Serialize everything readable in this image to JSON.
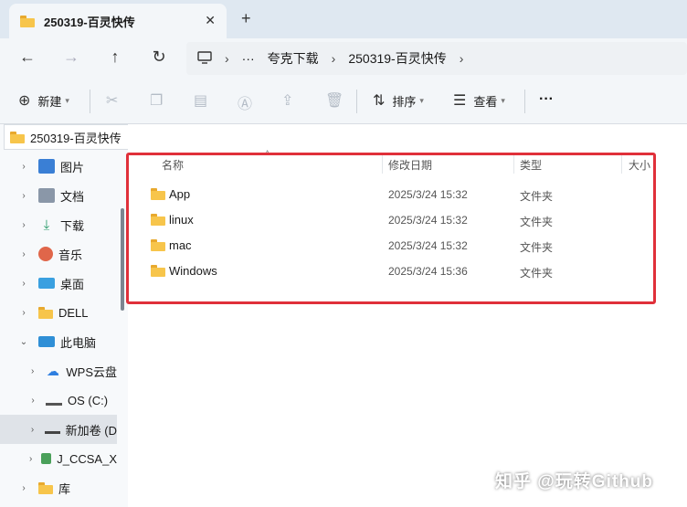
{
  "tab": {
    "title": "250319-百灵快传",
    "close": "✕",
    "new": "+"
  },
  "nav": {
    "back": "←",
    "forward": "→",
    "up": "↑",
    "refresh": "↻"
  },
  "address": {
    "ellipsis": "···",
    "sep": "›",
    "crumb1": "夸克下载",
    "crumb2": "250319-百灵快传"
  },
  "toolbar": {
    "new_label": "新建",
    "sort_label": "排序",
    "view_label": "查看",
    "more": "···"
  },
  "sidebar": {
    "pathtab": "250319-百灵快传",
    "items": [
      {
        "label": "图片"
      },
      {
        "label": "文档"
      },
      {
        "label": "下载"
      },
      {
        "label": "音乐"
      },
      {
        "label": "桌面"
      },
      {
        "label": "DELL"
      },
      {
        "label": "此电脑"
      },
      {
        "label": "WPS云盘"
      },
      {
        "label": "OS (C:)"
      },
      {
        "label": "新加卷 (D"
      },
      {
        "label": "J_CCSA_X"
      },
      {
        "label": "库"
      }
    ]
  },
  "columns": {
    "name": "名称",
    "date": "修改日期",
    "type": "类型",
    "size": "大小"
  },
  "files": [
    {
      "name": "App",
      "date": "2025/3/24 15:32",
      "type": "文件夹"
    },
    {
      "name": "linux",
      "date": "2025/3/24 15:32",
      "type": "文件夹"
    },
    {
      "name": "mac",
      "date": "2025/3/24 15:32",
      "type": "文件夹"
    },
    {
      "name": "Windows",
      "date": "2025/3/24 15:36",
      "type": "文件夹"
    }
  ],
  "watermark": "知乎 @玩转Github",
  "colors": {
    "highlight_box": "#e0303a",
    "folder": "#f7c54b"
  }
}
